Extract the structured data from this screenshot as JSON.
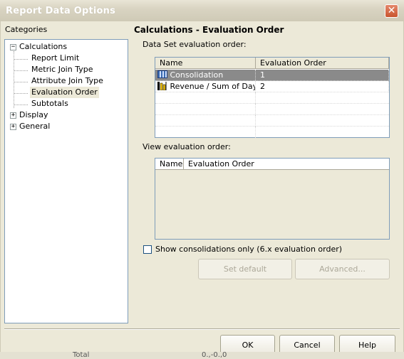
{
  "window": {
    "title": "Report Data Options",
    "close_glyph": "✕"
  },
  "categories": {
    "label": "Categories",
    "tree": [
      {
        "label": "Calculations",
        "expander": "−",
        "children": [
          "Report Limit",
          "Metric Join Type",
          "Attribute Join Type",
          "Evaluation Order",
          "Subtotals"
        ]
      },
      {
        "label": "Display",
        "expander": "+"
      },
      {
        "label": "General",
        "expander": "+"
      }
    ],
    "selected": "Evaluation Order"
  },
  "panel": {
    "title": "Calculations - Evaluation Order",
    "dataset_label": "Data Set evaluation order:",
    "dataset_columns": [
      "Name",
      "Evaluation Order"
    ],
    "dataset_rows": [
      {
        "name": "Consolidation",
        "order": "1",
        "icon": "consolidation-icon",
        "selected": true
      },
      {
        "name": "Revenue / Sum of Days",
        "order": "2",
        "icon": "metric-icon",
        "selected": false
      }
    ],
    "view_label": "View evaluation order:",
    "view_columns": [
      "Name",
      "Evaluation Order"
    ],
    "checkbox_label": "Show consolidations only (6.x evaluation order)",
    "checkbox_checked": false,
    "set_default_label": "Set default",
    "advanced_label": "Advanced..."
  },
  "footer": {
    "ok_label": "OK",
    "cancel_label": "Cancel",
    "help_label": "Help"
  },
  "background_fragments": {
    "total": "Total",
    "number": "0.,-0.,0"
  },
  "colors": {
    "selection": "#8a8a8a",
    "border": "#7f9db9",
    "face": "#ece9d8"
  }
}
